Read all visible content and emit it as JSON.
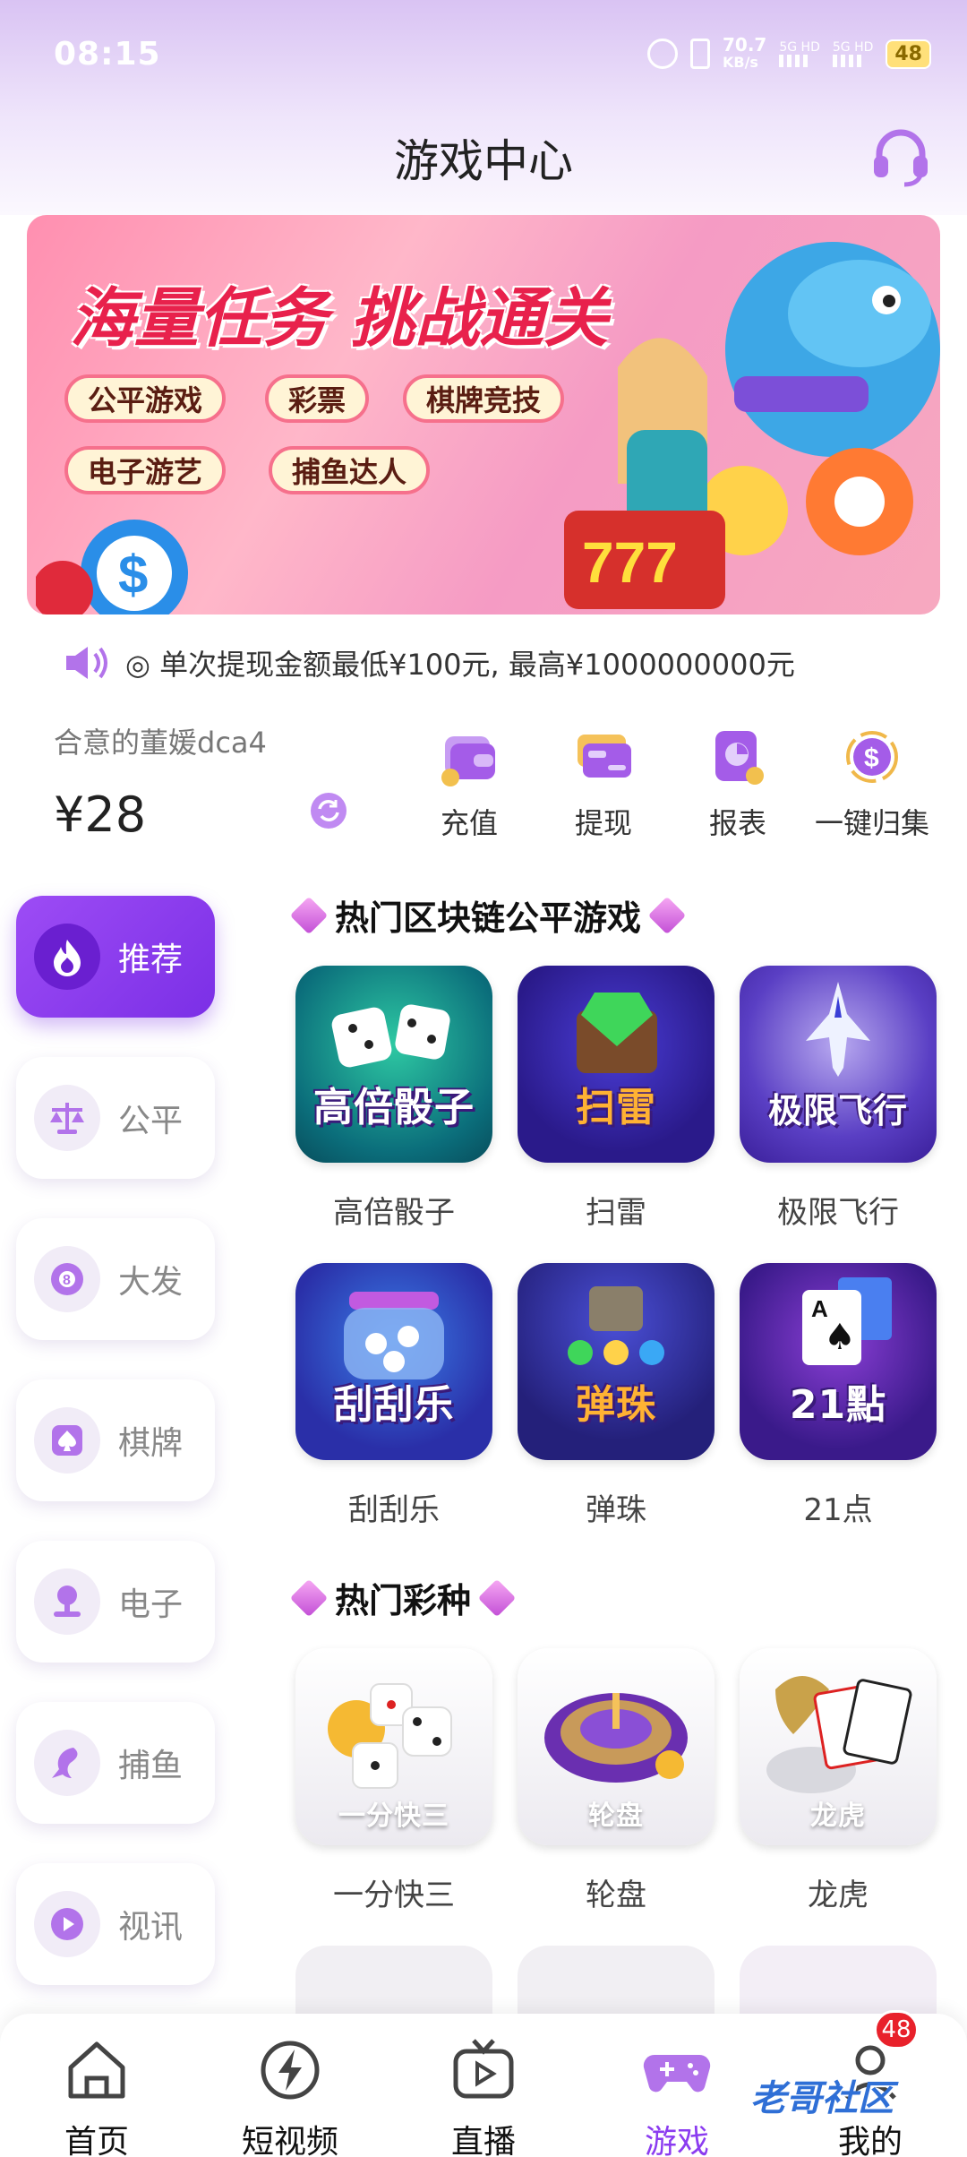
{
  "status_bar": {
    "time": "08:15",
    "speed_value": "70.7",
    "speed_unit": "KB/s",
    "sig1": "5G HD",
    "sig2": "5G HD",
    "battery": "48"
  },
  "header": {
    "title": "游戏中心"
  },
  "banner": {
    "title": "海量任务 挑战通关",
    "chips": [
      "公平游戏",
      "彩票",
      "棋牌竞技",
      "电子游艺",
      "捕鱼达人"
    ]
  },
  "notice": {
    "text": "◎ 单次提现金额最低¥100元, 最高¥1000000000元"
  },
  "account": {
    "username": "合意的董媛dca4",
    "balance": "¥28"
  },
  "actions": [
    {
      "label": "充值",
      "icon": "wallet-icon"
    },
    {
      "label": "提现",
      "icon": "card-icon"
    },
    {
      "label": "报表",
      "icon": "report-icon"
    },
    {
      "label": "一键归集",
      "icon": "collect-icon"
    }
  ],
  "sidebar": [
    {
      "label": "推荐",
      "icon": "fire-icon",
      "active": true
    },
    {
      "label": "公平",
      "icon": "scale-icon"
    },
    {
      "label": "大发",
      "icon": "ball-8-icon"
    },
    {
      "label": "棋牌",
      "icon": "spade-icon"
    },
    {
      "label": "电子",
      "icon": "joystick-icon"
    },
    {
      "label": "捕鱼",
      "icon": "fish-icon"
    },
    {
      "label": "视讯",
      "icon": "play-icon"
    }
  ],
  "sections": {
    "hot_blockchain": {
      "title": "热门区块链公平游戏",
      "games": [
        {
          "name": "高倍骰子",
          "tile_text": "高倍骰子"
        },
        {
          "name": "扫雷",
          "tile_text": "扫雷"
        },
        {
          "name": "极限飞行",
          "tile_text": "极限飞行"
        },
        {
          "name": "刮刮乐",
          "tile_text": "刮刮乐"
        },
        {
          "name": "弹珠",
          "tile_text": "弹珠"
        },
        {
          "name": "21点",
          "tile_text": "21點"
        }
      ]
    },
    "hot_lottery": {
      "title": "热门彩种",
      "games": [
        {
          "name": "一分快三",
          "tile_text": "一分快三"
        },
        {
          "name": "轮盘",
          "tile_text": "轮盘"
        },
        {
          "name": "龙虎",
          "tile_text": "龙虎"
        }
      ]
    }
  },
  "tabbar": {
    "tabs": [
      {
        "label": "首页",
        "icon": "home-icon"
      },
      {
        "label": "短视频",
        "icon": "lightning-icon"
      },
      {
        "label": "直播",
        "icon": "tv-icon"
      },
      {
        "label": "游戏",
        "icon": "gamepad-icon",
        "active": true
      },
      {
        "label": "我的",
        "icon": "user-icon"
      }
    ],
    "badge": "48"
  },
  "watermark": "老哥社区",
  "colors": {
    "accent": "#8b3cf0",
    "banner_red": "#e8214c",
    "badge": "#e8212b"
  }
}
